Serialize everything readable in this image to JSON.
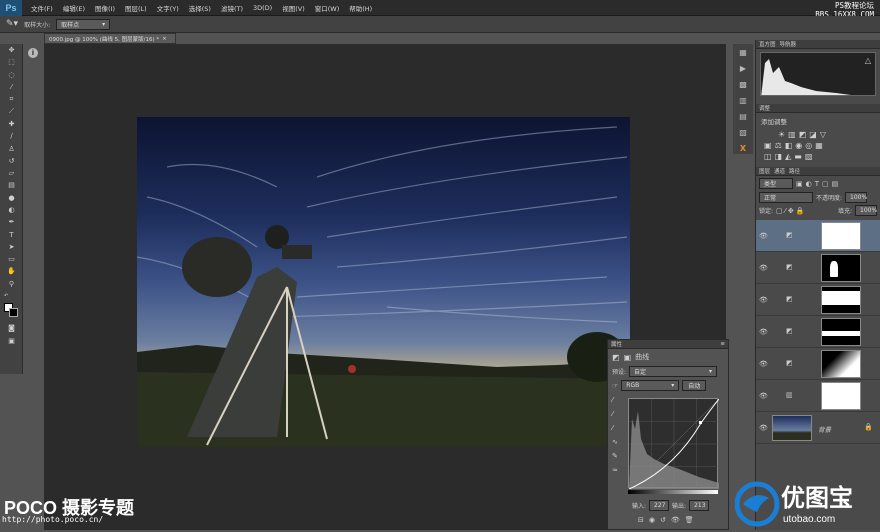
{
  "menubar": {
    "logo": "Ps",
    "items": [
      "文件(F)",
      "编辑(E)",
      "图像(I)",
      "图层(L)",
      "文字(Y)",
      "选择(S)",
      "滤镜(T)",
      "3D(D)",
      "视图(V)",
      "窗口(W)",
      "帮助(H)"
    ],
    "watermark_line1": "PS教程论坛",
    "watermark_line2": "BBS.16XX8.COM"
  },
  "options": {
    "sample_size_label": "取样大小:",
    "sample_size_value": "取样点"
  },
  "document": {
    "tab_title": "0900.jpg @ 100% (曲线 5, 图层蒙版/16) *"
  },
  "properties": {
    "tab": "属性",
    "panel_title": "曲线",
    "preset_label": "预设:",
    "preset_value": "自定",
    "channel_value": "RGB",
    "auto_button": "自动",
    "input_label": "输入:",
    "input_value": "227",
    "output_label": "输出:",
    "output_value": "213"
  },
  "panels": {
    "histogram_tab": "直方图",
    "navigator_tab": "导航器",
    "adjustments_tab": "调整",
    "adjustments_add": "添加调整",
    "layers_tab": "图层",
    "channels_tab": "通道",
    "paths_tab": "路径",
    "kind_filter": "类型",
    "blend_mode": "正常",
    "opacity_label": "不透明度:",
    "opacity_value": "100%",
    "lock_label": "锁定:",
    "fill_label": "填充:",
    "fill_value": "100%",
    "background_layer_name": "背景"
  },
  "watermarks": {
    "poco": "POCO 摄影专题",
    "poco_url": "http://photo.poco.cn/",
    "utobao_cn": "优图宝",
    "utobao_url": "utobao.com"
  },
  "colors": {
    "accent_blue": "#1a7fd4",
    "selected_layer": "#5d6f85"
  }
}
